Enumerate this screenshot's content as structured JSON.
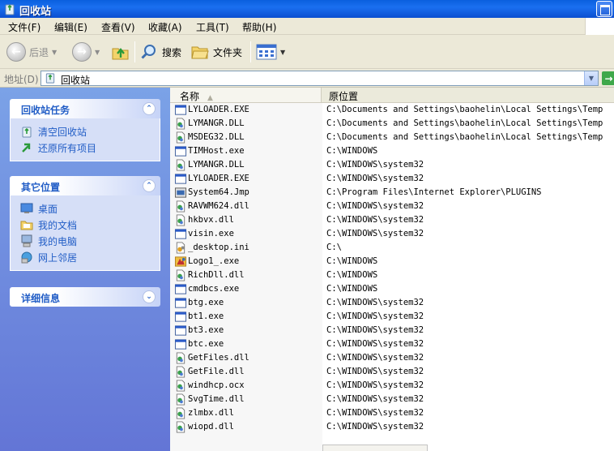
{
  "window": {
    "title": "回收站"
  },
  "menu": [
    {
      "label": "文件(F)"
    },
    {
      "label": "编辑(E)"
    },
    {
      "label": "查看(V)"
    },
    {
      "label": "收藏(A)"
    },
    {
      "label": "工具(T)"
    },
    {
      "label": "帮助(H)"
    }
  ],
  "toolbar": {
    "back_label": "后退",
    "search_label": "搜索",
    "folders_label": "文件夹"
  },
  "address": {
    "label": "地址(D)",
    "value": "回收站"
  },
  "taskpane": {
    "recycle_tasks": {
      "title": "回收站任务",
      "links": [
        {
          "label": "清空回收站",
          "icon": "empty-recycle-bin-icon"
        },
        {
          "label": "还原所有项目",
          "icon": "restore-all-icon"
        }
      ]
    },
    "other_places": {
      "title": "其它位置",
      "links": [
        {
          "label": "桌面",
          "icon": "desktop-icon"
        },
        {
          "label": "我的文档",
          "icon": "my-documents-icon"
        },
        {
          "label": "我的电脑",
          "icon": "my-computer-icon"
        },
        {
          "label": "网上邻居",
          "icon": "network-places-icon"
        }
      ]
    },
    "details": {
      "title": "详细信息"
    }
  },
  "filelist": {
    "columns": {
      "name": "名称",
      "location": "原位置"
    },
    "files": [
      {
        "name": "LYLOADER.EXE",
        "location": "C:\\Documents and Settings\\baohelin\\Local Settings\\Temp",
        "icon": "exe-window-icon"
      },
      {
        "name": "LYMANGR.DLL",
        "location": "C:\\Documents and Settings\\baohelin\\Local Settings\\Temp",
        "icon": "dll-file-icon"
      },
      {
        "name": "MSDEG32.DLL",
        "location": "C:\\Documents and Settings\\baohelin\\Local Settings\\Temp",
        "icon": "dll-file-icon"
      },
      {
        "name": "TIMHost.exe",
        "location": "C:\\WINDOWS",
        "icon": "exe-window-icon"
      },
      {
        "name": "LYMANGR.DLL",
        "location": "C:\\WINDOWS\\system32",
        "icon": "dll-file-icon"
      },
      {
        "name": "LYLOADER.EXE",
        "location": "C:\\WINDOWS\\system32",
        "icon": "exe-window-icon"
      },
      {
        "name": "System64.Jmp",
        "location": "C:\\Program Files\\Internet Explorer\\PLUGINS",
        "icon": "jmp-file-icon"
      },
      {
        "name": "RAVWM624.dll",
        "location": "C:\\WINDOWS\\system32",
        "icon": "dll-file-icon"
      },
      {
        "name": "hkbvx.dll",
        "location": "C:\\WINDOWS\\system32",
        "icon": "dll-file-icon"
      },
      {
        "name": "visin.exe",
        "location": "C:\\WINDOWS\\system32",
        "icon": "exe-window-icon"
      },
      {
        "name": "_desktop.ini",
        "location": "C:\\",
        "icon": "ini-file-icon"
      },
      {
        "name": "Logo1_.exe",
        "location": "C:\\WINDOWS",
        "icon": "logo-exe-icon"
      },
      {
        "name": "RichDll.dll",
        "location": "C:\\WINDOWS",
        "icon": "dll-file-icon"
      },
      {
        "name": "cmdbcs.exe",
        "location": "C:\\WINDOWS",
        "icon": "exe-window-icon"
      },
      {
        "name": "btg.exe",
        "location": "C:\\WINDOWS\\system32",
        "icon": "exe-window-icon"
      },
      {
        "name": "bt1.exe",
        "location": "C:\\WINDOWS\\system32",
        "icon": "exe-window-icon"
      },
      {
        "name": "bt3.exe",
        "location": "C:\\WINDOWS\\system32",
        "icon": "exe-window-icon"
      },
      {
        "name": "btc.exe",
        "location": "C:\\WINDOWS\\system32",
        "icon": "exe-window-icon"
      },
      {
        "name": "GetFiles.dll",
        "location": "C:\\WINDOWS\\system32",
        "icon": "dll-file-icon"
      },
      {
        "name": "GetFile.dll",
        "location": "C:\\WINDOWS\\system32",
        "icon": "dll-file-icon"
      },
      {
        "name": "windhcp.ocx",
        "location": "C:\\WINDOWS\\system32",
        "icon": "dll-file-icon"
      },
      {
        "name": "SvgTime.dll",
        "location": "C:\\WINDOWS\\system32",
        "icon": "dll-file-icon"
      },
      {
        "name": "zlmbx.dll",
        "location": "C:\\WINDOWS\\system32",
        "icon": "dll-file-icon"
      },
      {
        "name": "wiopd.dll",
        "location": "C:\\WINDOWS\\system32",
        "icon": "dll-file-icon"
      }
    ]
  }
}
